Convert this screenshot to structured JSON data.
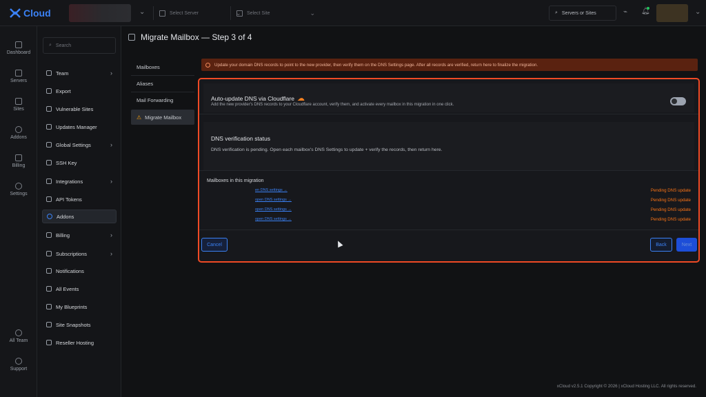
{
  "app": {
    "logo_text": "Cloud",
    "brand_color": "#3b82f6"
  },
  "topbar": {
    "server_select_placeholder": "Select Server",
    "site_select_placeholder": "Select Site",
    "search_label": "Servers or Sites"
  },
  "rail": {
    "items": [
      {
        "label": "Dashboard",
        "icon": "dashboard-icon"
      },
      {
        "label": "Servers",
        "icon": "servers-icon"
      },
      {
        "label": "Sites",
        "icon": "sites-icon"
      },
      {
        "label": "Addons",
        "icon": "addons-icon"
      },
      {
        "label": "Billing",
        "icon": "billing-icon"
      },
      {
        "label": "Settings",
        "icon": "settings-icon"
      }
    ],
    "bottom_items": [
      {
        "label": "All Team",
        "icon": "team-icon"
      },
      {
        "label": "Support",
        "icon": "support-icon"
      }
    ]
  },
  "sidebar": {
    "search_placeholder": "Search",
    "items": [
      {
        "label": "Team",
        "has_chevron": true
      },
      {
        "label": "Export",
        "has_chevron": false
      },
      {
        "label": "Vulnerable Sites",
        "has_chevron": false
      },
      {
        "label": "Updates Manager",
        "has_chevron": false
      },
      {
        "label": "Global Settings",
        "has_chevron": true
      },
      {
        "label": "SSH Key",
        "has_chevron": false
      },
      {
        "label": "Integrations",
        "has_chevron": true
      },
      {
        "label": "API Tokens",
        "has_chevron": false
      },
      {
        "label": "Addons",
        "has_chevron": false,
        "active": true
      },
      {
        "label": "Billing",
        "has_chevron": true
      },
      {
        "label": "Subscriptions",
        "has_chevron": true
      },
      {
        "label": "Notifications",
        "has_chevron": false
      },
      {
        "label": "All Events",
        "has_chevron": false
      },
      {
        "label": "My Blueprints",
        "has_chevron": false
      },
      {
        "label": "Site Snapshots",
        "has_chevron": false
      },
      {
        "label": "Reseller Hosting",
        "has_chevron": false
      }
    ]
  },
  "page": {
    "title": "Migrate Mailbox — Step 3 of 4"
  },
  "steps": [
    {
      "label": "Mailboxes",
      "active": false
    },
    {
      "label": "Aliases",
      "active": false
    },
    {
      "label": "Mail Forwarding",
      "active": false
    },
    {
      "label": "Migrate Mailbox",
      "active": true
    }
  ],
  "banner": {
    "text": "Update your domain DNS records to point to the new provider, then verify them on the DNS Settings page. After all records are verified, return here to finalize the migration.",
    "color": "#5a2210"
  },
  "cloudflare": {
    "title": "Auto-update DNS via Cloudflare",
    "description": "Add the new provider's DNS records to your Cloudflare account, verify them, and activate every mailbox in this migration in one click.",
    "toggle_on": false
  },
  "dns_status": {
    "title": "DNS verification status",
    "description": "DNS verification is pending. Open each mailbox's DNS Settings to update + verify the records, then return here."
  },
  "mailboxes": {
    "title": "Mailboxes in this migration",
    "rows": [
      {
        "link": "en DNS settings →",
        "status": "Pending DNS update"
      },
      {
        "link": "open DNS settings →",
        "status": "Pending DNS update"
      },
      {
        "link": "open DNS settings →",
        "status": "Pending DNS update"
      },
      {
        "link": "open DNS settings →",
        "status": "Pending DNS update"
      }
    ],
    "status_color": "#f97316"
  },
  "actions": {
    "cancel": "Cancel",
    "back": "Back",
    "next": "Next"
  },
  "footer": {
    "text": "xCloud v2.5.1 Copyright © 2026 | xCloud Hosting LLC. All rights reserved."
  }
}
